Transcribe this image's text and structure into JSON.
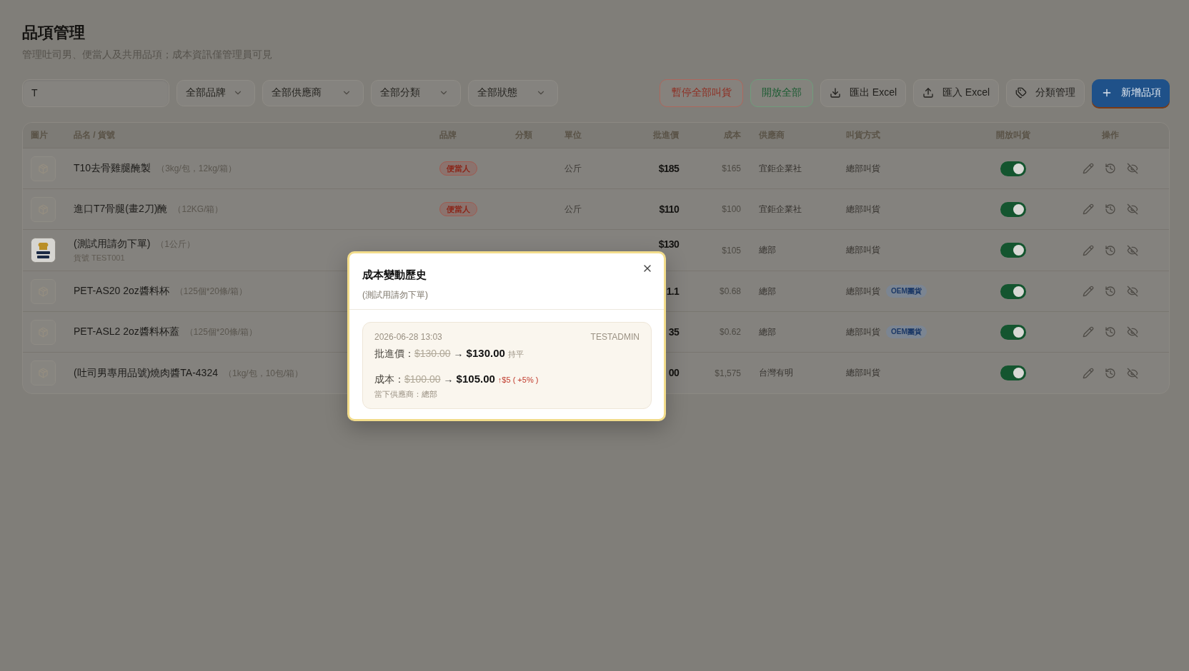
{
  "page": {
    "title": "品項管理",
    "subtitle": "管理吐司男、便當人及共用品項；成本資訊僅管理員可見"
  },
  "toolbar": {
    "search": {
      "value": "T"
    },
    "filters": [
      {
        "label": "全部品牌"
      },
      {
        "label": "全部供應商"
      },
      {
        "label": "全部分類"
      },
      {
        "label": "全部狀態"
      }
    ],
    "actions": [
      {
        "kind": "danger",
        "label": "暫停全部叫貨"
      },
      {
        "kind": "success",
        "label": "開放全部"
      },
      {
        "kind": "export",
        "label": "匯出 Excel"
      },
      {
        "kind": "import",
        "label": "匯入 Excel"
      },
      {
        "kind": "category",
        "label": "分類管理"
      },
      {
        "kind": "create",
        "label": "新增品項"
      }
    ]
  },
  "table": {
    "columns": [
      "圖片",
      "品名 / 貨號",
      "品牌",
      "分類",
      "單位",
      "批進價",
      "成本",
      "供應商",
      "叫貨方式",
      "開放叫貨",
      "操作"
    ],
    "rows": [
      {
        "thumbnail": {
          "kind": "placeholder"
        },
        "name": "T10去骨雞腿醃製",
        "spec": "（3kg/包，12kg/箱）",
        "brand": "便當人",
        "unit": "公斤",
        "price": "$185",
        "cost": "$165",
        "supplier": "宜鉅企業社",
        "order_method": "總部叫貨",
        "open": true
      },
      {
        "thumbnail": {
          "kind": "placeholder"
        },
        "name": "進口T7骨腿(畫2刀)醃",
        "spec": "（12KG/箱）",
        "brand": "便當人",
        "unit": "公斤",
        "price": "$110",
        "cost": "$100",
        "supplier": "宜鉅企業社",
        "order_method": "總部叫貨",
        "open": true
      },
      {
        "thumbnail": {
          "kind": "logo"
        },
        "name": "(測試用請勿下單)",
        "spec": "（1公斤）",
        "code": "貨號 TEST001",
        "price": "$130",
        "cost": "$105",
        "supplier": "總部",
        "order_method": "總部叫貨",
        "open": true
      },
      {
        "thumbnail": {
          "kind": "placeholder"
        },
        "name": "PET-AS20 2oz醬料杯",
        "spec": "（125個*20條/箱）",
        "price": "1.1",
        "cost": "$0.68",
        "supplier": "總部",
        "order_method": "總部叫貨",
        "order_tag": "OEM團貨",
        "open": true
      },
      {
        "thumbnail": {
          "kind": "placeholder"
        },
        "name": "PET-ASL2 2oz醬料杯蓋",
        "spec": "（125個*20條/箱）",
        "price": "35",
        "cost": "$0.62",
        "supplier": "總部",
        "order_method": "總部叫貨",
        "order_tag": "OEM團貨",
        "open": true
      },
      {
        "thumbnail": {
          "kind": "placeholder"
        },
        "name": "(吐司男專用品號)燒肉醬TA-4324",
        "spec": "（1kg/包，10包/箱）",
        "price": "00",
        "cost": "$1,575",
        "supplier": "台灣有明",
        "order_method": "總部叫貨",
        "open": true
      }
    ]
  },
  "dialog": {
    "title": "成本變動歷史",
    "subtitle": "(測試用請勿下單)",
    "entries": [
      {
        "time": "2026-06-28 13:03",
        "user": "TESTADMIN",
        "changes": [
          {
            "kind": "flat",
            "label": "批進價：",
            "old": "$130.00",
            "arrow": "→",
            "new": "$130.00",
            "delta": "持平"
          },
          {
            "kind": "up",
            "label": "成本：",
            "old": "$100.00",
            "arrow": "→",
            "new": "$105.00",
            "delta": "↑$5 ( +5% )"
          }
        ],
        "note": "當下供應商：總部"
      }
    ]
  }
}
